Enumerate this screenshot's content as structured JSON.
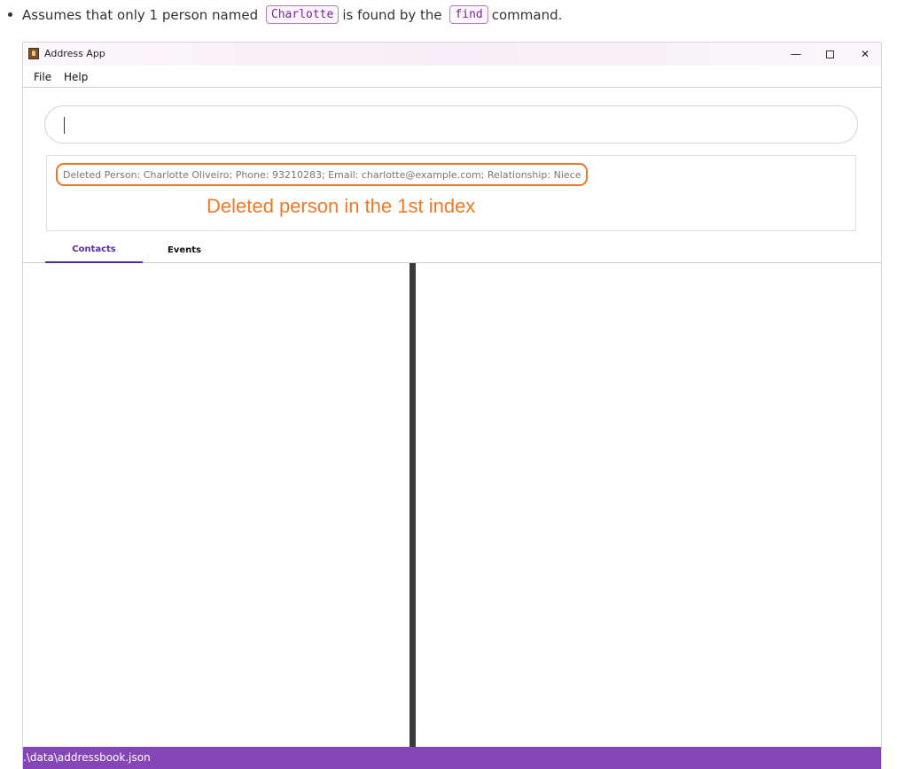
{
  "doc": {
    "prefix": "Assumes that only 1 person named",
    "code1": "Charlotte",
    "middle": "is found by the",
    "code2": "find",
    "suffix": "command."
  },
  "window": {
    "title": "Address App",
    "minimize_glyph": "—",
    "close_glyph": "✕"
  },
  "menu": {
    "file": "File",
    "help": "Help"
  },
  "command_box": {
    "value": ""
  },
  "result": {
    "text": "Deleted Person: Charlotte Oliveiro; Phone: 93210283; Email: charlotte@example.com; Relationship: Niece",
    "annotation": "Deleted person in the 1st index",
    "highlight_color": "#e9782b"
  },
  "tabs": [
    {
      "label": "Contacts",
      "active": true
    },
    {
      "label": "Events",
      "active": false
    }
  ],
  "status": {
    "path": ".\\data\\addressbook.json",
    "color": "#8547b8"
  },
  "icons": {
    "app": "address-book-icon",
    "minimize": "minimize-icon",
    "maximize": "maximize-icon",
    "close": "close-icon"
  }
}
